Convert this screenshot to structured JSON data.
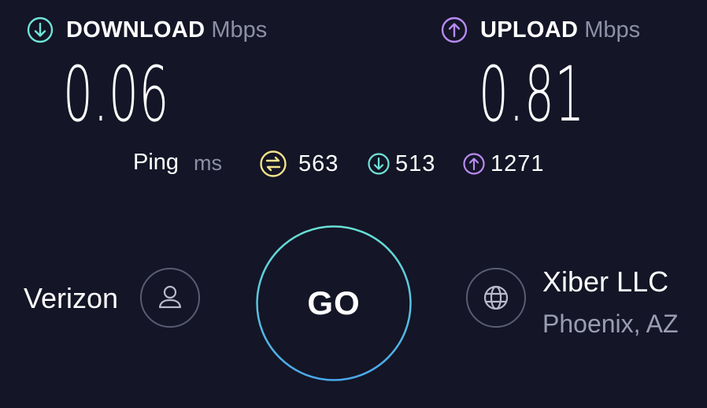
{
  "colors": {
    "background": "#141526",
    "download_accent": "#6fe3d7",
    "upload_accent": "#b88af5",
    "ping_accent": "#f3e38b",
    "go_ring_top": "#67e0d4",
    "go_ring_bottom": "#4aa7ea"
  },
  "download": {
    "icon": "download-arrow-circle-icon",
    "label": "DOWNLOAD",
    "unit": "Mbps",
    "value": "0.06"
  },
  "upload": {
    "icon": "upload-arrow-circle-icon",
    "label": "UPLOAD",
    "unit": "Mbps",
    "value": "0.81"
  },
  "ping": {
    "label": "Ping",
    "unit": "ms",
    "idle": {
      "icon": "ping-idle-icon",
      "value": "563"
    },
    "download": {
      "icon": "download-arrow-circle-icon",
      "value": "513"
    },
    "upload": {
      "icon": "upload-arrow-circle-icon",
      "value": "1271"
    }
  },
  "go_button": {
    "label": "GO"
  },
  "provider": {
    "name": "Verizon",
    "icon": "user-icon"
  },
  "server": {
    "icon": "globe-icon",
    "name": "Xiber LLC",
    "location": "Phoenix, AZ"
  }
}
